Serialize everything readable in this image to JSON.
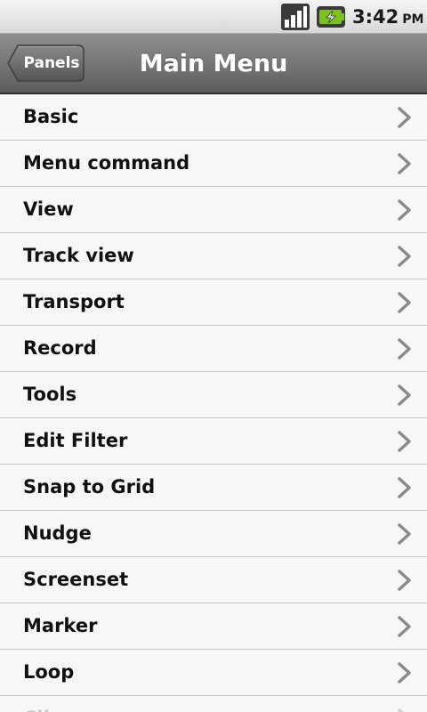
{
  "status_bar": {
    "time": "3:42",
    "ampm": "PM",
    "icons": [
      "signal-icon",
      "battery-charging-icon"
    ],
    "battery_color": "#7cc21e"
  },
  "header": {
    "back_label": "Panels",
    "title": "Main Menu"
  },
  "menu": {
    "items": [
      {
        "label": "Basic"
      },
      {
        "label": "Menu command"
      },
      {
        "label": "View"
      },
      {
        "label": "Track view"
      },
      {
        "label": "Transport"
      },
      {
        "label": "Record"
      },
      {
        "label": "Tools"
      },
      {
        "label": "Edit Filter"
      },
      {
        "label": "Snap to Grid"
      },
      {
        "label": "Nudge"
      },
      {
        "label": "Screenset"
      },
      {
        "label": "Marker"
      },
      {
        "label": "Loop"
      },
      {
        "label": "Clip"
      }
    ],
    "chevron_icon": "chevron-right-icon"
  }
}
